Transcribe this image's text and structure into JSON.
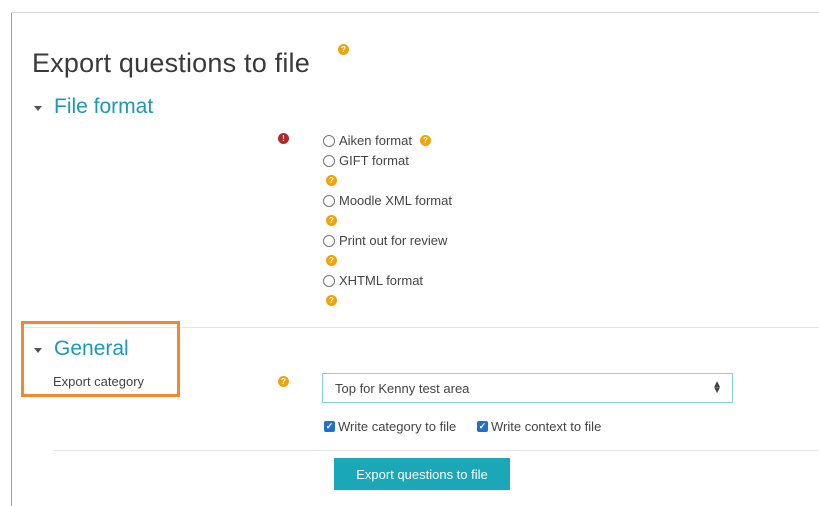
{
  "page": {
    "title": "Export questions to file",
    "help_glyph": "?"
  },
  "file_format": {
    "heading": "File format",
    "error_glyph": "!",
    "options": [
      {
        "label": "Aiken format",
        "selected": false
      },
      {
        "label": "GIFT format",
        "selected": false
      },
      {
        "label": "Moodle XML format",
        "selected": false
      },
      {
        "label": "Print out for review",
        "selected": false
      },
      {
        "label": "XHTML format",
        "selected": false
      }
    ]
  },
  "general": {
    "heading": "General",
    "export_category_label": "Export category",
    "category_value": "Top for Kenny test area",
    "write_category_label": "Write category to file",
    "write_category_checked": true,
    "write_context_label": "Write context to file",
    "write_context_checked": true
  },
  "actions": {
    "export_button": "Export questions to file"
  },
  "colors": {
    "accent": "#1a9bb0",
    "button": "#1aa7b8",
    "help": "#f0a30a",
    "error": "#b42a2a",
    "highlight": "#f08a30"
  },
  "icons": {
    "caret": "caret-down-icon",
    "help": "help-icon",
    "error": "error-icon",
    "check": "checkmark-icon"
  }
}
